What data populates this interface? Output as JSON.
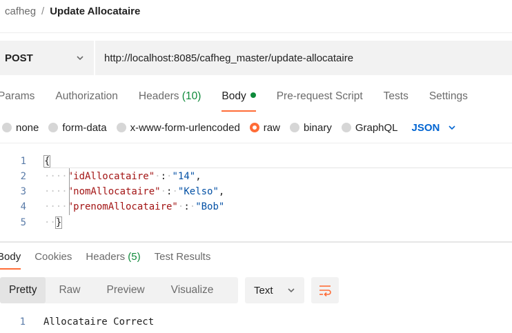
{
  "breadcrumb": {
    "parent": "cafheg",
    "separator": "/",
    "current": "Update Allocataire"
  },
  "request": {
    "method": "POST",
    "url": "http://localhost:8085/cafheg_master/update-allocataire"
  },
  "request_tabs": {
    "params": "Params",
    "authorization": "Authorization",
    "headers": "Headers",
    "headers_count": "(10)",
    "body": "Body",
    "prerequest": "Pre-request Script",
    "tests": "Tests",
    "settings": "Settings"
  },
  "body_types": {
    "none": "none",
    "form_data": "form-data",
    "urlencoded": "x-www-form-urlencoded",
    "raw": "raw",
    "binary": "binary",
    "graphql": "GraphQL",
    "format": "JSON"
  },
  "editor": {
    "line_numbers": [
      "1",
      "2",
      "3",
      "4",
      "5"
    ],
    "open_brace": "{",
    "close_brace": "}",
    "fields": [
      {
        "key": "\"idAllocataire\"",
        "value": "\"14\"",
        "trail": ","
      },
      {
        "key": "\"nomAllocataire\"",
        "value": "\"Kelso\"",
        "trail": ","
      },
      {
        "key": "\"prenomAllocataire\"",
        "value": "\"Bob\"",
        "trail": ""
      }
    ]
  },
  "response_tabs": {
    "body": "Body",
    "cookies": "Cookies",
    "headers": "Headers",
    "headers_count": "(5)",
    "test_results": "Test Results"
  },
  "response_view": {
    "pretty": "Pretty",
    "raw": "Raw",
    "preview": "Preview",
    "visualize": "Visualize",
    "format": "Text"
  },
  "response": {
    "line_number": "1",
    "text": "Allocataire Correct"
  },
  "colors": {
    "accent": "#ff6c37",
    "count_green": "#0e8a3a",
    "link_blue": "#0265d2"
  }
}
